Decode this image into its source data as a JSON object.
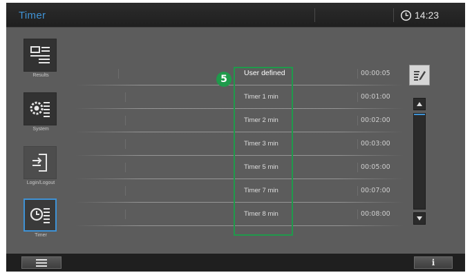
{
  "header": {
    "title": "Timer",
    "clock_time": "14:23"
  },
  "nav": {
    "results_label": "Results",
    "system_label": "System",
    "login_label": "Login/Logout",
    "timer_label": "Timer"
  },
  "callout_number": "5",
  "timers": [
    {
      "name": "User defined",
      "time": "00:00:05"
    },
    {
      "name": "Timer 1 min",
      "time": "00:01:00"
    },
    {
      "name": "Timer 2 min",
      "time": "00:02:00"
    },
    {
      "name": "Timer 3 min",
      "time": "00:03:00"
    },
    {
      "name": "Timer 5 min",
      "time": "00:05:00"
    },
    {
      "name": "Timer 7 min",
      "time": "00:07:00"
    },
    {
      "name": "Timer 8 min",
      "time": "00:08:00"
    }
  ],
  "footer": {
    "info_label": "i"
  },
  "colors": {
    "accent": "#3f93d6",
    "callout": "#1f9a4b"
  },
  "icons": {
    "clock": "clock-icon",
    "results": "results-icon",
    "system": "system-icon",
    "login": "login-icon",
    "timer": "timer-icon",
    "edit": "edit-icon",
    "scroll_up": "triangle-up-icon",
    "scroll_down": "triangle-down-icon",
    "menu": "hamburger-icon"
  }
}
